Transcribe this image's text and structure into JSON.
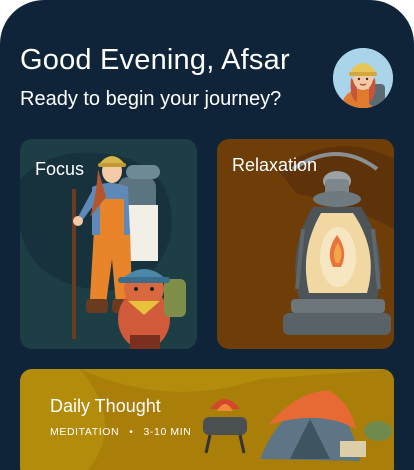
{
  "header": {
    "greeting": "Good Evening, Afsar",
    "subtitle": "Ready to begin your journey?"
  },
  "cards": {
    "focus": {
      "title": "Focus"
    },
    "relaxation": {
      "title": "Relaxation"
    },
    "daily_thought": {
      "title": "Daily Thought",
      "category": "MEDITATION",
      "separator": "•",
      "duration": "3-10 MIN"
    }
  },
  "colors": {
    "background": "#0f2438",
    "focus_card": "#1e3e46",
    "relaxation_card": "#6e3d08",
    "daily_card": "#b38c0c"
  }
}
